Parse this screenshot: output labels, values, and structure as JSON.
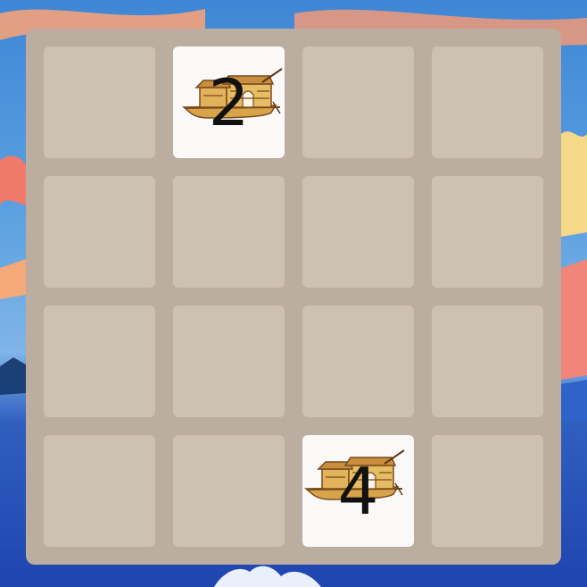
{
  "game": {
    "grid_size": 4,
    "tiles": [
      {
        "row": 0,
        "col": 1,
        "value": "2",
        "icon": "boat-icon"
      },
      {
        "row": 3,
        "col": 2,
        "value": "4",
        "icon": "boat-icon"
      }
    ]
  },
  "colors": {
    "board": "#bbada0",
    "empty_cell": "#cdc1b4",
    "tile": "#fbf9f8",
    "text": "#111111"
  }
}
